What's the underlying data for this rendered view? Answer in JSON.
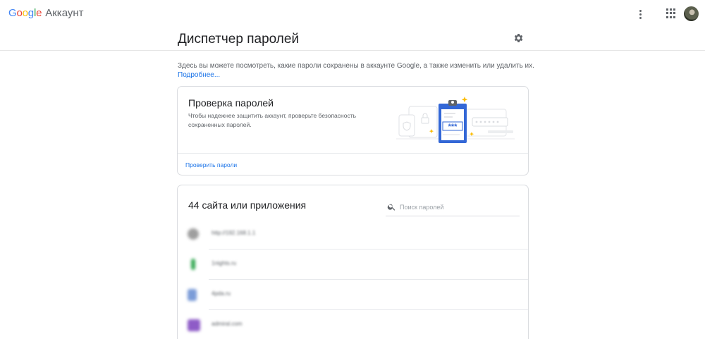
{
  "app": {
    "logo_letters": [
      "G",
      "o",
      "o",
      "g",
      "l",
      "e"
    ],
    "account_label": "Аккаунт"
  },
  "header": {
    "title": "Диспетчер паролей"
  },
  "intro": {
    "text": "Здесь вы можете посмотреть, какие пароли сохранены в аккаунте Google, а также изменить или удалить их.",
    "more_link": "Подробнее..."
  },
  "password_check": {
    "title": "Проверка паролей",
    "description": "Чтобы надежнее защитить аккаунт, проверьте безопасность сохраненных паролей.",
    "action_label": "Проверить пароли",
    "illustration_text": "***"
  },
  "saved_passwords": {
    "title": "44 сайта или приложения",
    "search_placeholder": "Поиск паролей",
    "search_value": "",
    "items": [
      {
        "site": "http://192.168.1.1",
        "favicon_color": "#9e9e9e",
        "favicon_icon": "globe-icon"
      },
      {
        "site": "1nights.ru",
        "favicon_color": "#34a853",
        "favicon_icon": "site-favicon-icon"
      },
      {
        "site": "4pda.ru",
        "favicon_color": "#7b9cd8",
        "favicon_icon": "site-favicon-icon"
      },
      {
        "site": "admiral.com",
        "favicon_color": "#8e5cc7",
        "favicon_icon": "site-favicon-icon"
      }
    ]
  },
  "colors": {
    "accent": "#1a73e8",
    "border": "#dadce0",
    "clipboard": "#3367d6",
    "sparkle": "#fbbc04"
  },
  "icons": {
    "more": "more-vert-icon",
    "apps": "apps-grid-icon",
    "settings": "gear-icon",
    "search": "search-icon"
  }
}
